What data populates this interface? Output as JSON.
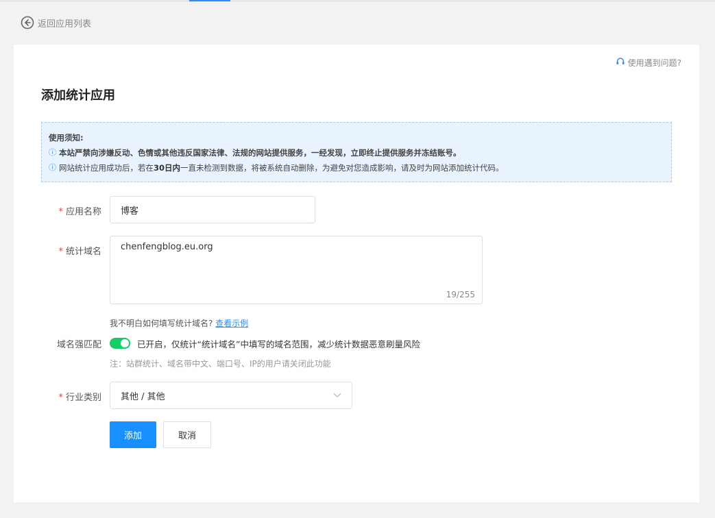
{
  "nav": {
    "back_label": "返回应用列表"
  },
  "page": {
    "help_label": "使用遇到问题?",
    "title": "添加统计应用"
  },
  "notice": {
    "title": "使用须知:",
    "line1": "本站严禁向涉嫌反动、色情或其他违反国家法律、法规的网站提供服务，一经发现，立即终止提供服务并冻结账号。",
    "line2_pre": "网站统计应用成功后，若在 ",
    "line2_bold": "30日内",
    "line2_post": " 一直未检测到数据，将被系统自动删除，为避免对您造成影响，请及时为网站添加统计代码。"
  },
  "form": {
    "app_name": {
      "label": "应用名称",
      "value": "博客"
    },
    "domain": {
      "label": "统计域名",
      "value": "chenfengblog.eu.org",
      "counter": "19/255"
    },
    "domain_help": {
      "text": "我不明白如何填写统计域名?",
      "link": "查看示例"
    },
    "strict_match": {
      "label": "域名强匹配",
      "toggle_text": "已开启，仅统计“统计域名”中填写的域名范围，减少统计数据恶意刷量风险",
      "note": "注：站群统计、域名带中文、端口号、IP的用户请关闭此功能"
    },
    "industry": {
      "label": "行业类别",
      "value": "其他 / 其他"
    }
  },
  "buttons": {
    "submit": "添加",
    "cancel": "取消"
  },
  "colors": {
    "primary": "#1890ff",
    "toggle_on": "#13ce66",
    "required": "#e5484d",
    "notice_bg": "#e8f3fd"
  }
}
